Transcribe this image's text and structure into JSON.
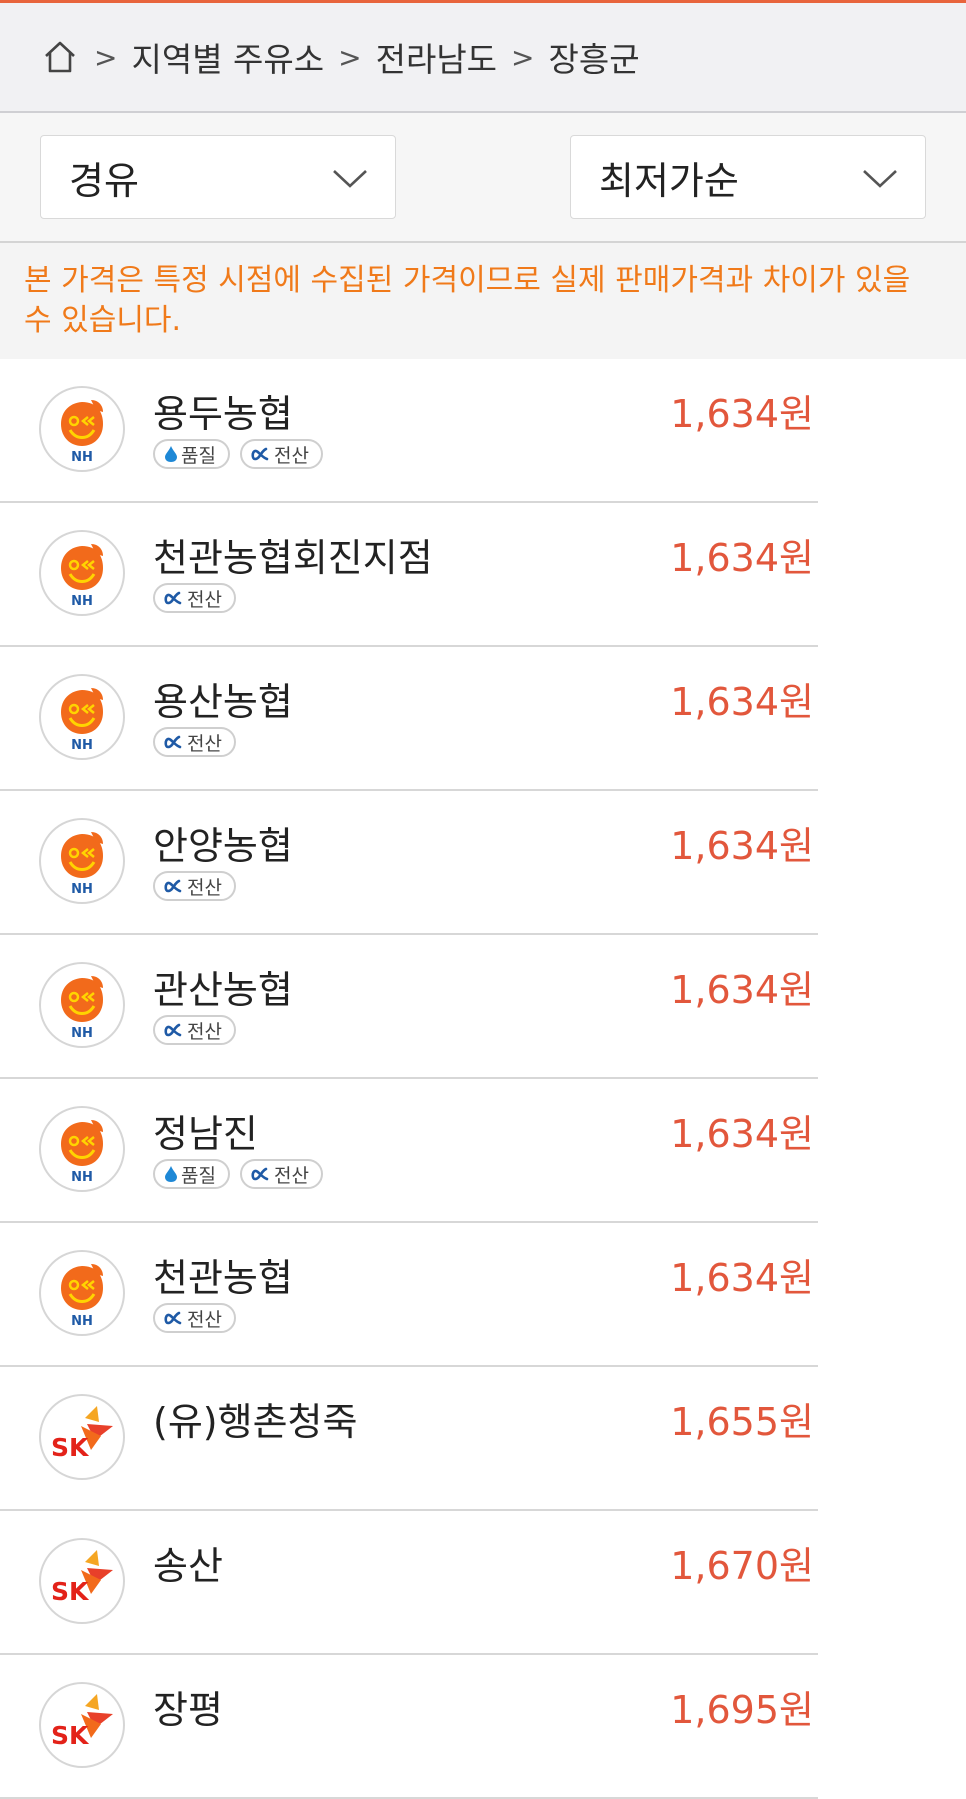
{
  "breadcrumb": {
    "home_icon": "home-icon",
    "items": [
      "지역별 주유소",
      "전라남도",
      "장흥군"
    ]
  },
  "filters": {
    "fuel": "경유",
    "sort": "최저가순"
  },
  "notice": "본 가격은 특정 시점에 수집된 가격이므로 실제 판매가격과 차이가 있을 수 있습니다.",
  "colors": {
    "accent": "#e2573c",
    "notice": "#f07a1a",
    "topline": "#e8643c"
  },
  "stations": [
    {
      "brand": "NH",
      "name": "용두농협",
      "price": "1,634원",
      "tags": [
        "품질",
        "전산"
      ]
    },
    {
      "brand": "NH",
      "name": "천관농협회진지점",
      "price": "1,634원",
      "tags": [
        "전산"
      ]
    },
    {
      "brand": "NH",
      "name": "용산농협",
      "price": "1,634원",
      "tags": [
        "전산"
      ]
    },
    {
      "brand": "NH",
      "name": "안양농협",
      "price": "1,634원",
      "tags": [
        "전산"
      ]
    },
    {
      "brand": "NH",
      "name": "관산농협",
      "price": "1,634원",
      "tags": [
        "전산"
      ]
    },
    {
      "brand": "NH",
      "name": "정남진",
      "price": "1,634원",
      "tags": [
        "품질",
        "전산"
      ]
    },
    {
      "brand": "NH",
      "name": "천관농협",
      "price": "1,634원",
      "tags": [
        "전산"
      ]
    },
    {
      "brand": "SK",
      "name": "(유)행촌청죽",
      "price": "1,655원",
      "tags": []
    },
    {
      "brand": "SK",
      "name": "송산",
      "price": "1,670원",
      "tags": []
    },
    {
      "brand": "SK",
      "name": "장평",
      "price": "1,695원",
      "tags": []
    }
  ]
}
